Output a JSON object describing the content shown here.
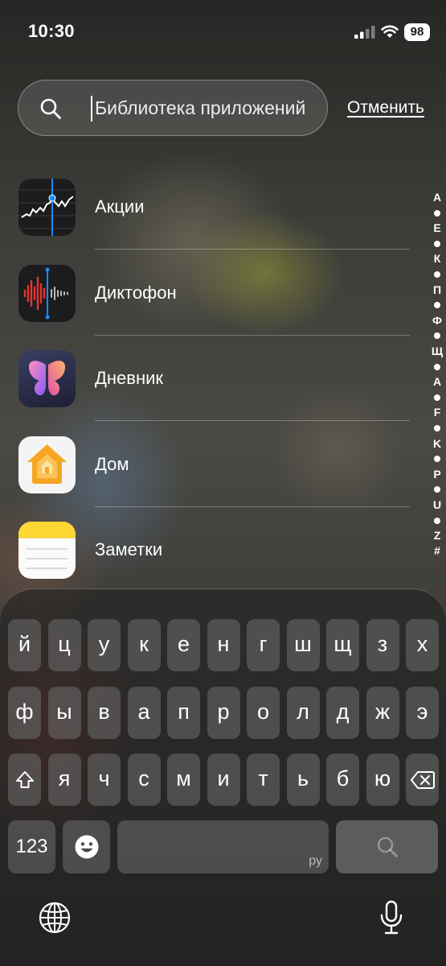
{
  "status_bar": {
    "time": "10:30",
    "battery": "98",
    "icons": [
      "signal-icon",
      "wifi-icon",
      "battery-icon"
    ]
  },
  "search": {
    "placeholder": "Библиотека приложений",
    "cancel_label": "Отменить",
    "icon": "search-icon"
  },
  "apps": [
    {
      "name": "Акции",
      "icon": "stocks-app-icon"
    },
    {
      "name": "Диктофон",
      "icon": "voice-memos-app-icon"
    },
    {
      "name": "Дневник",
      "icon": "journal-app-icon"
    },
    {
      "name": "Дом",
      "icon": "home-app-icon"
    },
    {
      "name": "Заметки",
      "icon": "notes-app-icon"
    }
  ],
  "index_letters": [
    "А",
    "Е",
    "К",
    "П",
    "Ф",
    "Щ",
    "A",
    "F",
    "K",
    "P",
    "U",
    "Z",
    "#"
  ],
  "keyboard": {
    "row1": [
      "й",
      "ц",
      "у",
      "к",
      "е",
      "н",
      "г",
      "ш",
      "щ",
      "з",
      "х"
    ],
    "row2": [
      "ф",
      "ы",
      "в",
      "а",
      "п",
      "р",
      "о",
      "л",
      "д",
      "ж",
      "э"
    ],
    "row3": [
      "я",
      "ч",
      "с",
      "м",
      "и",
      "т",
      "ь",
      "б",
      "ю"
    ],
    "numbers_label": "123",
    "space_language": "ру",
    "icons": [
      "shift-icon",
      "delete-icon",
      "emoji-icon",
      "search-icon",
      "globe-icon",
      "microphone-icon"
    ]
  },
  "colors": {
    "stocks_bg": "#1c1c1e",
    "stocks_accent": "#1a8cff",
    "voice_memos_red": "#e5352d",
    "home_orange": "#f6a623",
    "notes_yellow": "#fdd835"
  }
}
